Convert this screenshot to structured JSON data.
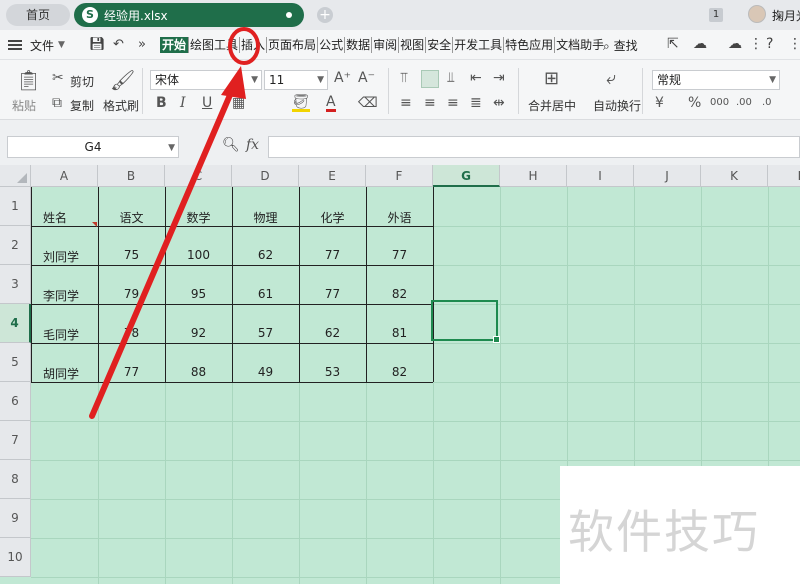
{
  "titlebar": {
    "home_tab": "首页",
    "file_tab": "经验用.xlsx",
    "window_badge": "1",
    "username": "掬月光"
  },
  "menubar": {
    "file_menu": "文件",
    "tabs": [
      "开始",
      "绘图工具",
      "插入",
      "页面布局",
      "公式",
      "数据",
      "审阅",
      "视图",
      "安全",
      "开发工具",
      "特色应用",
      "文档助手"
    ],
    "active_tab": "开始",
    "search": "查找"
  },
  "ribbon": {
    "paste": "粘贴",
    "cut": "剪切",
    "copy": "复制",
    "format_painter": "格式刷",
    "font_name": "宋体",
    "font_size": "11",
    "merge_center": "合并居中",
    "wrap_text": "自动换行",
    "number_format": "常规"
  },
  "formula_bar": {
    "name_box": "G4",
    "fx_label": "fx",
    "formula": ""
  },
  "sheet": {
    "columns": [
      "A",
      "B",
      "C",
      "D",
      "E",
      "F",
      "G",
      "H",
      "I",
      "J",
      "K",
      "L"
    ],
    "rows": [
      "1",
      "2",
      "3",
      "4",
      "5",
      "6",
      "7",
      "8",
      "9",
      "10"
    ],
    "selected_column": "G",
    "selected_row": "4",
    "headers": [
      "姓名",
      "语文",
      "数学",
      "物理",
      "化学",
      "外语"
    ],
    "data": [
      [
        "刘同学",
        "75",
        "100",
        "62",
        "77",
        "77"
      ],
      [
        "李同学",
        "79",
        "95",
        "61",
        "77",
        "82"
      ],
      [
        "毛同学",
        "78",
        "92",
        "57",
        "62",
        "81"
      ],
      [
        "胡同学",
        "77",
        "88",
        "49",
        "53",
        "82"
      ]
    ]
  },
  "watermark": "软件技巧",
  "colors": {
    "accent": "#1f6e4a",
    "sheet_bg": "#c1e8d4",
    "annotation": "#e02020"
  }
}
